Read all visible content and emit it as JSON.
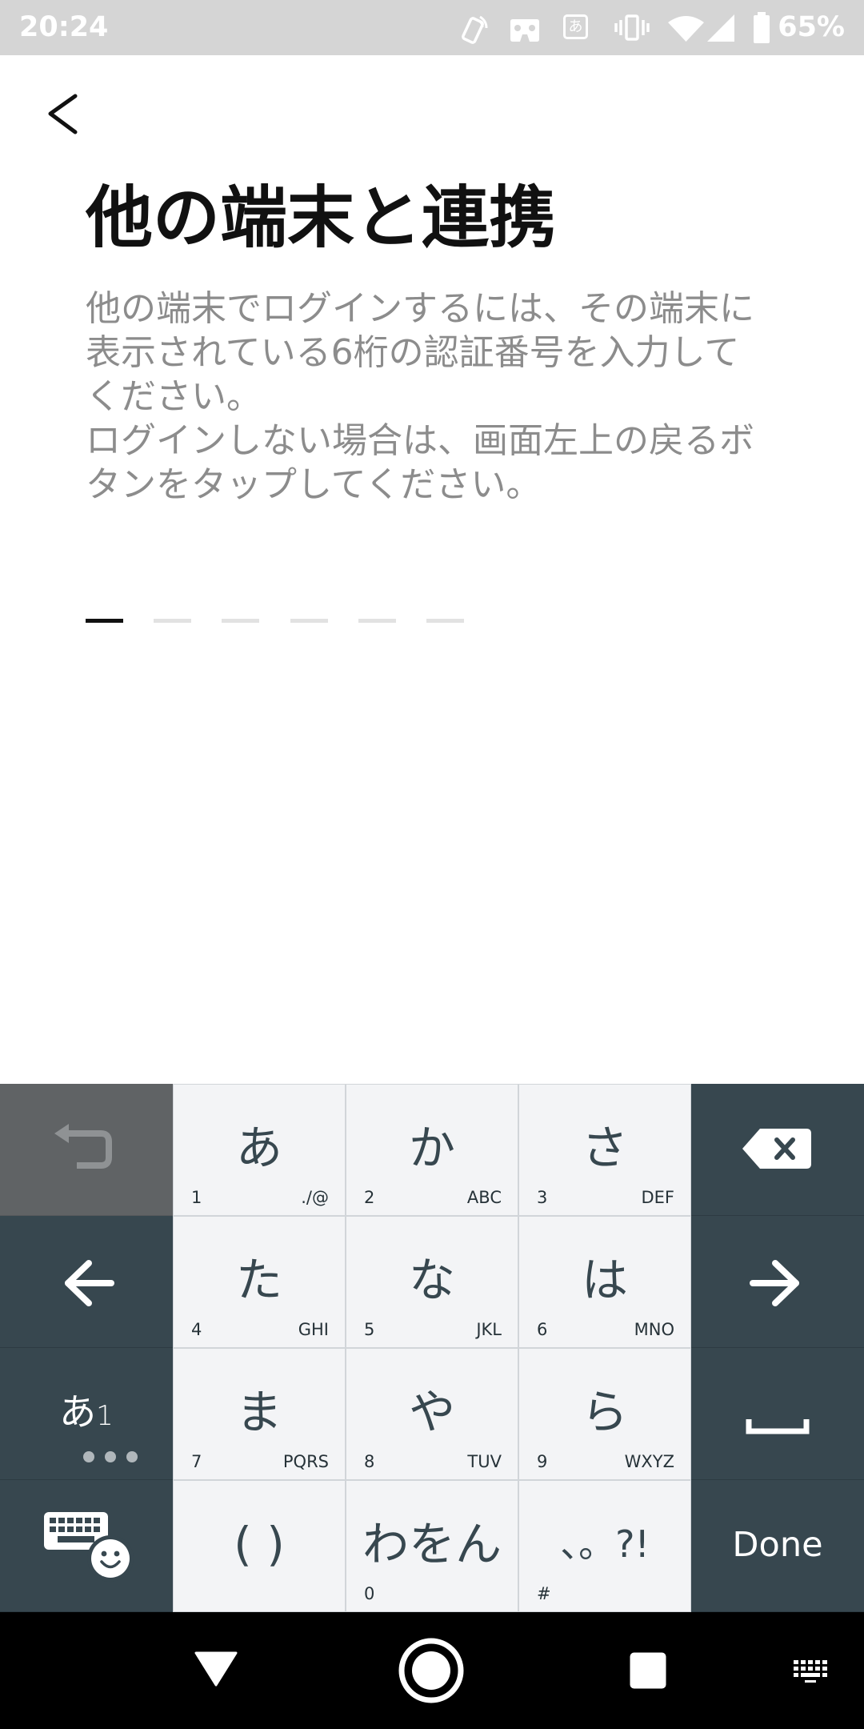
{
  "colors": {
    "status_bar_bg": "#d5d5d5",
    "status_fg": "#ffffff",
    "title": "#111111",
    "description": "#8c8c8c",
    "pin_active": "#111111",
    "pin_inactive": "#e2e2e2",
    "key_light": "#f3f4f6",
    "key_light_border": "#d1d5d9",
    "key_dark": "#37474f",
    "key_disabled": "#606365",
    "key_text": "#37474f",
    "nav_bar_bg": "#000000"
  },
  "status_bar": {
    "time": "20:24",
    "ime_label": "あ",
    "battery_percent": "65%",
    "icons": [
      "nfc-icon",
      "vr-headset-icon",
      "ime-icon",
      "vibrate-icon",
      "wifi-icon",
      "signal-icon",
      "battery-icon"
    ]
  },
  "header": {
    "back_icon": "chevron-left-icon"
  },
  "content": {
    "title": "他の端末と連携",
    "description": [
      "他の端末でログインするには、その端末に表示されている6桁の認証番号を入力してください。",
      "ログインしない場合は、画面左上の戻るボタンをタップしてください。"
    ]
  },
  "pin_input": {
    "slots": 6,
    "active_slot": 0
  },
  "keyboard": {
    "rows": [
      [
        {
          "icon": "undo-icon",
          "enabled": false
        },
        {
          "label": "あ",
          "num": "1",
          "sub": "./@"
        },
        {
          "label": "か",
          "num": "2",
          "sub": "ABC"
        },
        {
          "label": "さ",
          "num": "3",
          "sub": "DEF"
        },
        {
          "icon": "backspace-icon"
        }
      ],
      [
        {
          "icon": "arrow-left-icon"
        },
        {
          "label": "た",
          "num": "4",
          "sub": "GHI"
        },
        {
          "label": "な",
          "num": "5",
          "sub": "JKL"
        },
        {
          "label": "は",
          "num": "6",
          "sub": "MNO"
        },
        {
          "icon": "arrow-right-icon"
        }
      ],
      [
        {
          "label": "あ",
          "num": "1",
          "icon": "more-dots-icon"
        },
        {
          "label": "ま",
          "num": "7",
          "sub": "PQRS"
        },
        {
          "label": "や",
          "num": "8",
          "sub": "TUV"
        },
        {
          "label": "ら",
          "num": "9",
          "sub": "WXYZ"
        },
        {
          "icon": "space-icon"
        }
      ],
      [
        {
          "icon": "keyboard-emoji-icon"
        },
        {
          "label": "( )"
        },
        {
          "label": "わをん",
          "num": "0"
        },
        {
          "label": "、。?!",
          "num": "#"
        },
        {
          "label": "Done"
        }
      ]
    ]
  },
  "nav_bar": {
    "icons": [
      "back-icon",
      "home-icon",
      "recents-icon",
      "keyboard-switch-icon"
    ]
  }
}
